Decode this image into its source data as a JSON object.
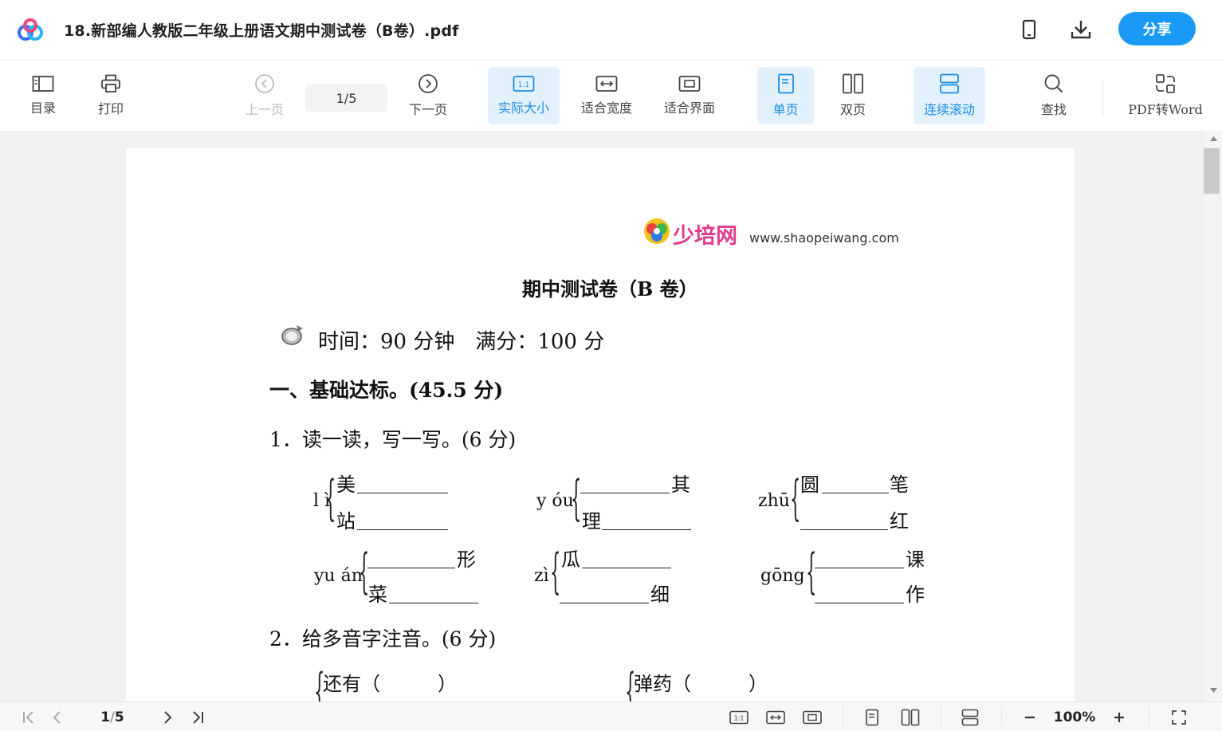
{
  "window": {
    "title": "18.新部编人教版二年级上册语文期中测试卷（B卷）.pdf",
    "share_label": "分享"
  },
  "toolbar": {
    "toc": "目录",
    "print": "打印",
    "prev": "上一页",
    "current_page": "1",
    "total_pages": "5",
    "page_separator": "/",
    "next": "下一页",
    "actual_size": "实际大小",
    "fit_width": "适合宽度",
    "fit_page": "适合界面",
    "single": "单页",
    "double": "双页",
    "continuous": "连续滚动",
    "find": "查找",
    "pdf_to_word": "PDF转Word",
    "accent_color": "#1a9af5"
  },
  "document": {
    "brand_text": "少培网",
    "brand_url": "www.shaopeiwang.com",
    "heading": "期中测试卷（B 卷）",
    "meta": "时间：90 分钟　满分：100 分",
    "section1": "一、基础达标。(45.5 分)",
    "q1": "1．读一读，写一写。(6 分)",
    "q1_items": {
      "li_pinyin": "l ì",
      "li_top": "美",
      "li_bottom": "站",
      "you_pinyin": "y óu",
      "you_top_right": "其",
      "you_bottom": "理",
      "zhu_pinyin": "zhū",
      "zhu_top": "圆",
      "zhu_top_right": "笔",
      "zhu_bottom_right": "红",
      "yuan_pinyin": "yu án",
      "yuan_top_right": "形",
      "yuan_bottom": "菜",
      "zi_pinyin": "zì",
      "zi_top": "瓜",
      "zi_bottom_right": "细",
      "gong_pinyin": "gōng",
      "gong_top_right": "课",
      "gong_bottom_right": "作"
    },
    "q2": "2．给多音字注音。(6 分)",
    "q2_items": {
      "left": "还有（　　　）",
      "right": "弹药（　　　）"
    }
  },
  "bottombar": {
    "current_page": "1",
    "page_separator": "/",
    "total_pages": "5",
    "zoom": "100%"
  }
}
